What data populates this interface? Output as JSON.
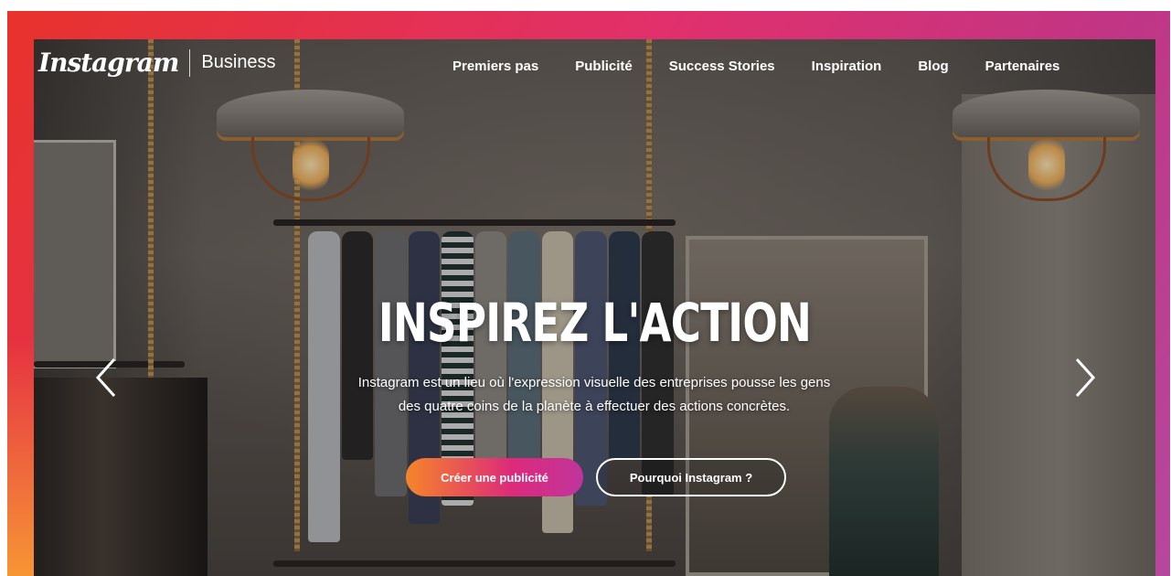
{
  "brand": {
    "logo_text": "Instagram",
    "product": "Business"
  },
  "nav": {
    "items": [
      {
        "label": "Premiers pas"
      },
      {
        "label": "Publicité"
      },
      {
        "label": "Success Stories"
      },
      {
        "label": "Inspiration"
      },
      {
        "label": "Blog"
      },
      {
        "label": "Partenaires"
      }
    ]
  },
  "hero": {
    "title": "INSPIREZ L'ACTION",
    "subtitle": "Instagram est un lieu où l'expression visuelle des entreprises pousse les gens des quatre coins de la planète à effectuer des actions concrètes.",
    "primary_cta": "Créer une publicité",
    "secondary_cta": "Pourquoi Instagram ?"
  },
  "carousel": {
    "prev_icon": "chevron-left-icon",
    "next_icon": "chevron-right-icon"
  },
  "colors": {
    "gradient_start": "#f58529",
    "gradient_mid": "#dd2a7b",
    "gradient_end": "#c0359c",
    "frame_red": "#e8322c",
    "frame_purple": "#b5489e"
  }
}
